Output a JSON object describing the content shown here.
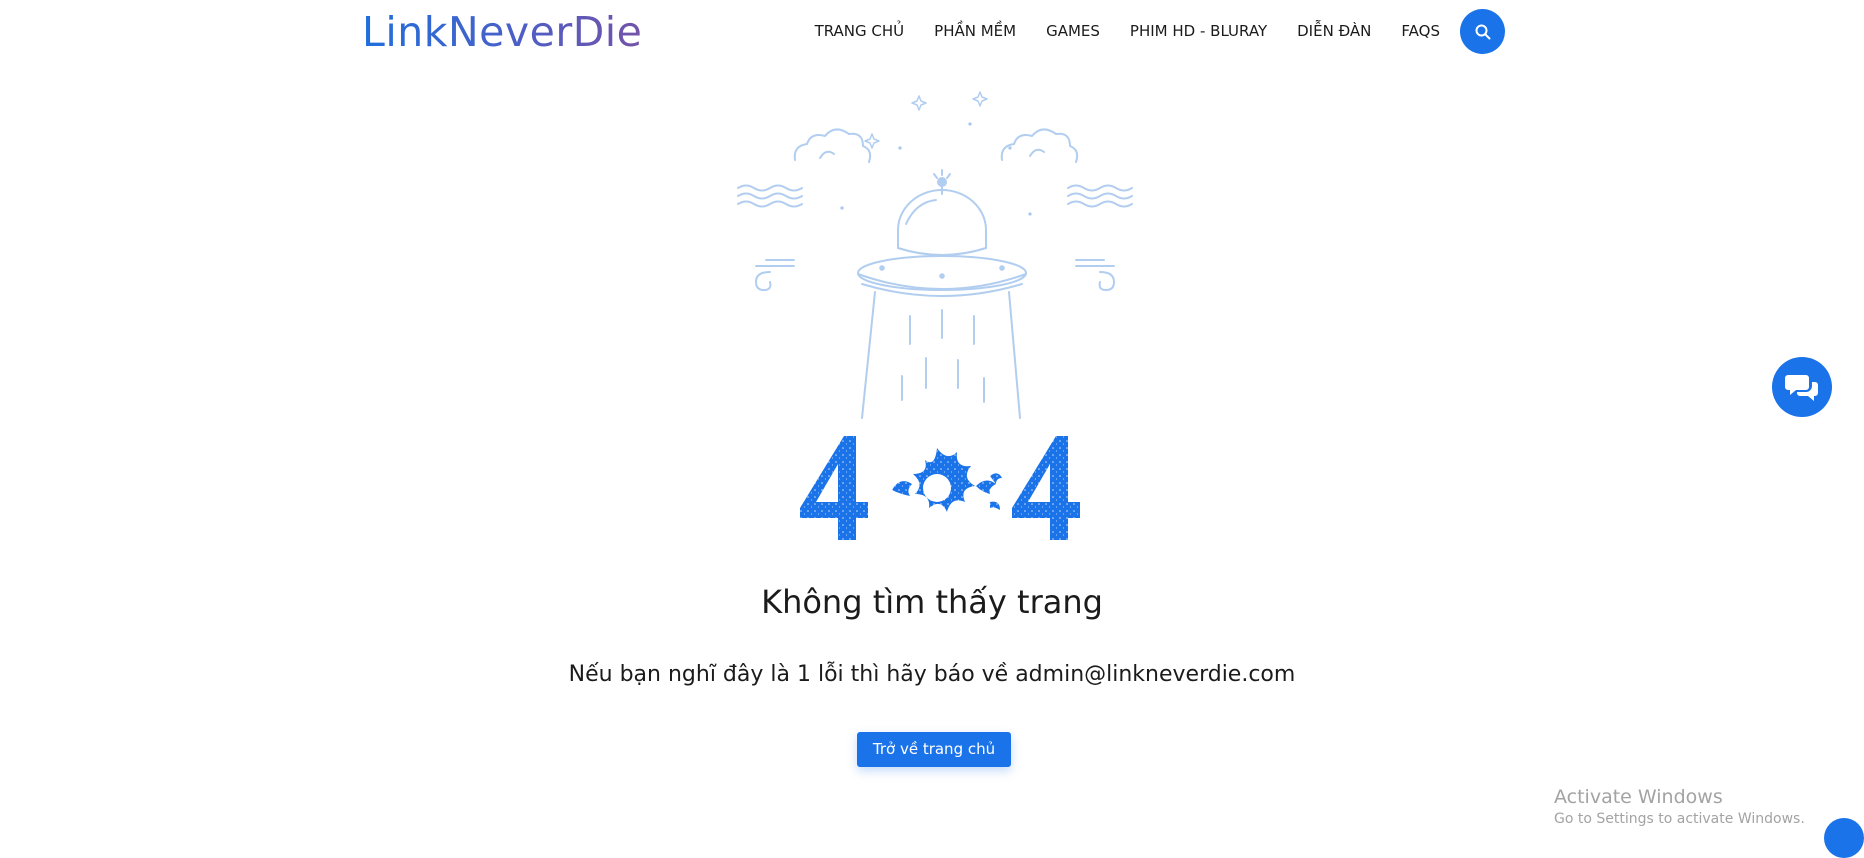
{
  "header": {
    "logo": "LinkNeverDie",
    "nav": [
      {
        "label": "TRANG CHỦ"
      },
      {
        "label": "PHẦN MỀM"
      },
      {
        "label": "GAMES"
      },
      {
        "label": "PHIM HD - BLURAY"
      },
      {
        "label": "DIỄN ĐÀN"
      },
      {
        "label": "FAQS"
      }
    ],
    "search_icon": "search-icon"
  },
  "error": {
    "code": "404",
    "title": "Không tìm thấy trang",
    "message": "Nếu bạn nghĩ đây là 1 lỗi thì hãy báo về admin@linkneverdie.com",
    "button_label": "Trở về trang chủ"
  },
  "floating": {
    "chat_icon": "chat-icon"
  },
  "windows_watermark": {
    "line1": "Activate Windows",
    "line2": "Go to Settings to activate Windows."
  },
  "colors": {
    "accent": "#1a73e8",
    "illustration": "#a9c8ee",
    "text": "#1b1b1b"
  }
}
